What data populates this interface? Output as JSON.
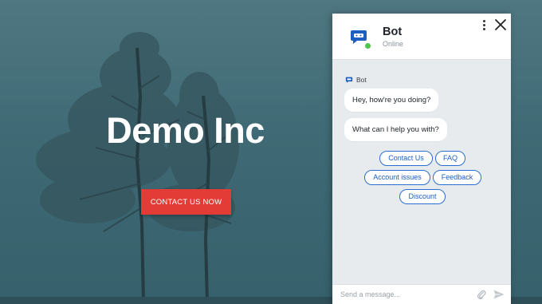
{
  "hero": {
    "title": "Demo Inc",
    "cta_label": "CONTACT US NOW"
  },
  "chat": {
    "bot_name": "Bot",
    "bot_status": "Online",
    "sender_label": "Bot",
    "messages": [
      "Hey, how're you doing?",
      "What can I help you with?"
    ],
    "quick_replies": [
      "Contact Us",
      "FAQ",
      "Account issues",
      "Feedback",
      "Discount"
    ],
    "composer_placeholder": "Send a message..."
  },
  "colors": {
    "accent": "#2a6fcf",
    "cta": "#e33b35",
    "online": "#4cc74a",
    "hero_bg": "#3f6a75"
  },
  "icons": [
    "chat-bubble-icon",
    "kebab-menu-icon",
    "close-icon",
    "paperclip-icon",
    "send-icon"
  ]
}
